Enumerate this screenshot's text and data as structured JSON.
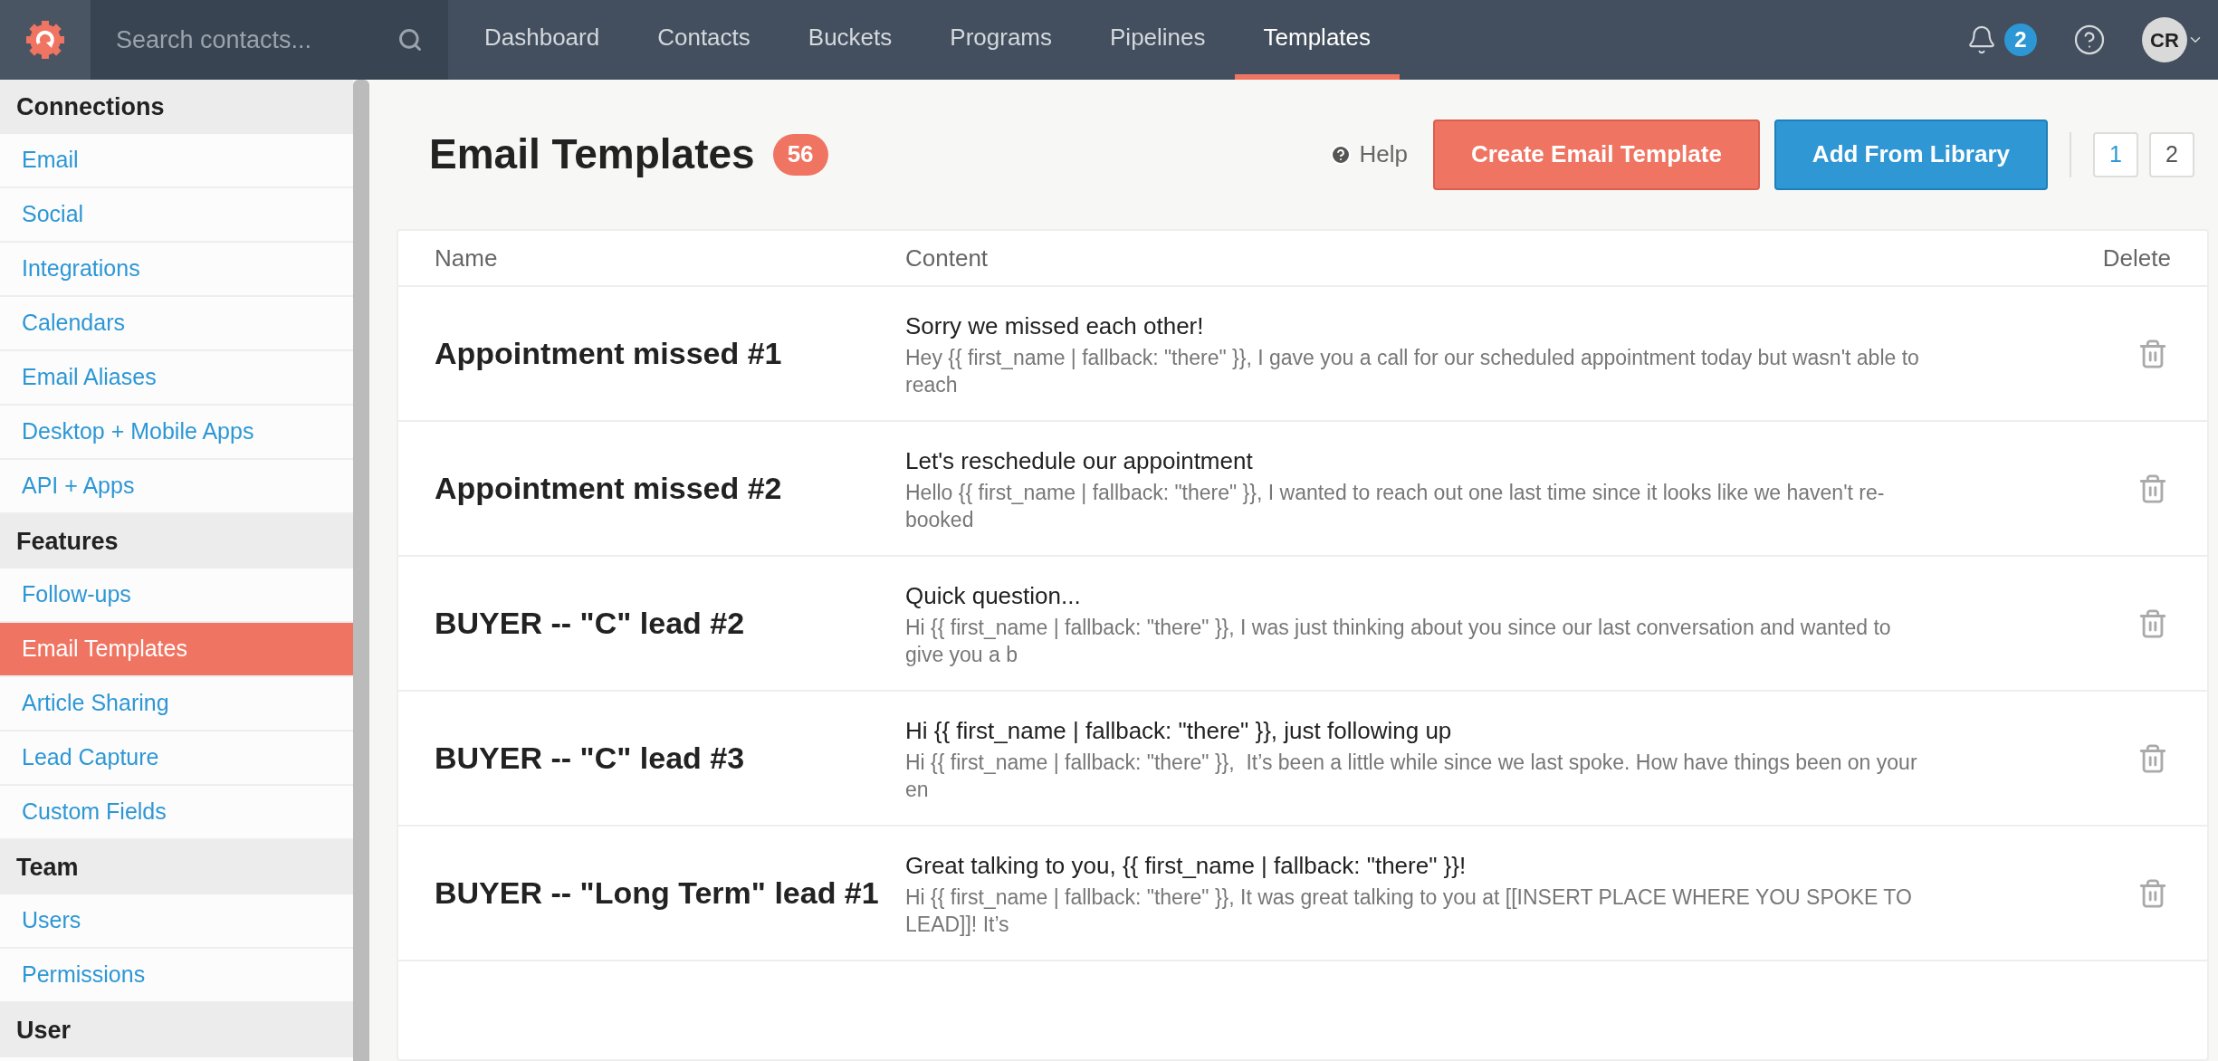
{
  "search": {
    "placeholder": "Search contacts..."
  },
  "nav": [
    {
      "label": "Dashboard",
      "selected": false
    },
    {
      "label": "Contacts",
      "selected": false
    },
    {
      "label": "Buckets",
      "selected": false
    },
    {
      "label": "Programs",
      "selected": false
    },
    {
      "label": "Pipelines",
      "selected": false
    },
    {
      "label": "Templates",
      "selected": true
    }
  ],
  "notifications": {
    "count": "2"
  },
  "avatar": {
    "initials": "CR"
  },
  "sidebar": [
    {
      "title": "Connections",
      "items": [
        {
          "label": "Email",
          "selected": false
        },
        {
          "label": "Social",
          "selected": false
        },
        {
          "label": "Integrations",
          "selected": false
        },
        {
          "label": "Calendars",
          "selected": false
        },
        {
          "label": "Email Aliases",
          "selected": false
        },
        {
          "label": "Desktop + Mobile Apps",
          "selected": false
        },
        {
          "label": "API + Apps",
          "selected": false
        }
      ]
    },
    {
      "title": "Features",
      "items": [
        {
          "label": "Follow-ups",
          "selected": false
        },
        {
          "label": "Email Templates",
          "selected": true
        },
        {
          "label": "Article Sharing",
          "selected": false
        },
        {
          "label": "Lead Capture",
          "selected": false
        },
        {
          "label": "Custom Fields",
          "selected": false
        }
      ]
    },
    {
      "title": "Team",
      "items": [
        {
          "label": "Users",
          "selected": false
        },
        {
          "label": "Permissions",
          "selected": false
        }
      ]
    },
    {
      "title": "User"
    }
  ],
  "page": {
    "title": "Email Templates",
    "count": "56",
    "help": "Help",
    "create_button": "Create Email Template",
    "library_button": "Add From Library",
    "pages": [
      {
        "label": "1",
        "selected": true
      },
      {
        "label": "2",
        "selected": false
      }
    ]
  },
  "table": {
    "columns": [
      "Name",
      "Content",
      "Delete"
    ],
    "rows": [
      {
        "name": "Appointment missed #1",
        "subject": "Sorry we missed each other!",
        "preview": "Hey {{ first_name | fallback: \"there\" }}, I gave you a call for our scheduled appointment today but wasn't able to reach"
      },
      {
        "name": "Appointment missed #2",
        "subject": "Let's reschedule our appointment",
        "preview": "Hello {{ first_name | fallback: \"there\" }}, I wanted to reach out one last time since it looks like we haven't re-booked"
      },
      {
        "name": "BUYER -- \"C\" lead #2",
        "subject": "Quick question...",
        "preview": "Hi {{ first_name | fallback: \"there\" }}, I was just thinking about you since our last conversation and wanted to give you a b"
      },
      {
        "name": "BUYER -- \"C\" lead #3",
        "subject": "Hi {{ first_name | fallback: \"there\" }}, just following up",
        "preview": "Hi {{ first_name | fallback: \"there\" }},  It’s been a little while since we last spoke. How have things been on your en"
      },
      {
        "name": "BUYER -- \"Long Term\" lead #1",
        "subject": "Great talking to you, {{ first_name | fallback: \"there\" }}!",
        "preview": "Hi {{ first_name | fallback: \"there\" }}, It was great talking to you at [[INSERT PLACE WHERE YOU SPOKE TO LEAD]]! It’s"
      }
    ]
  }
}
